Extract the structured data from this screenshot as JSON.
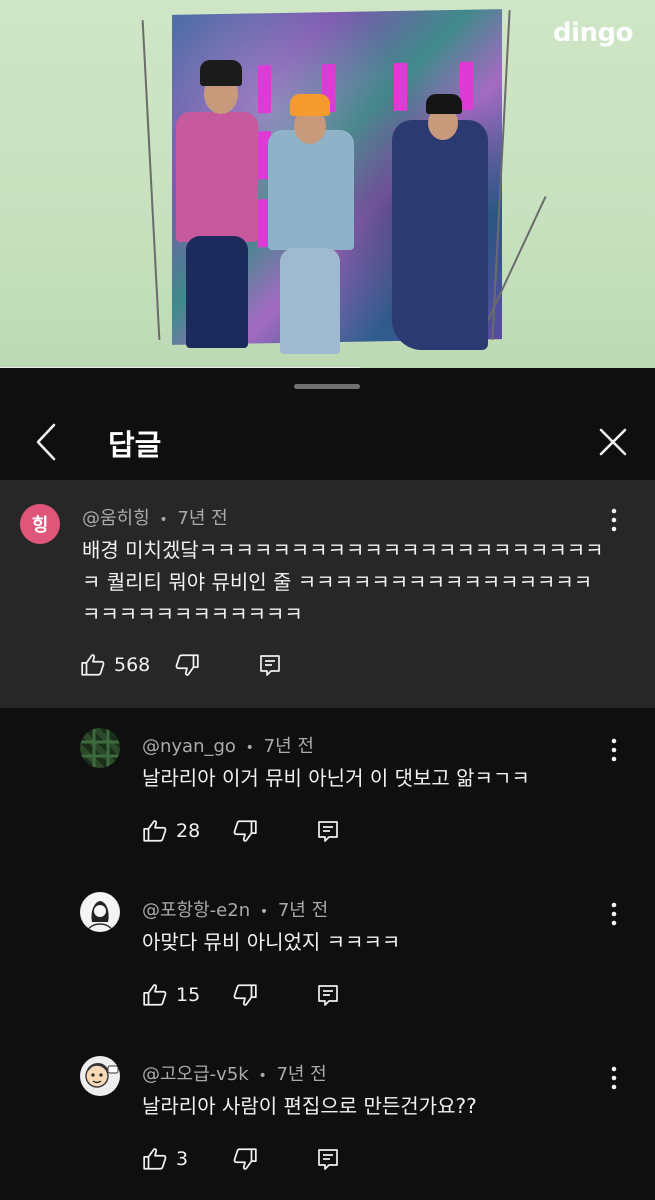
{
  "video": {
    "logo": "dingo"
  },
  "panel": {
    "title": "답글"
  },
  "parent_comment": {
    "avatar_text": "힝",
    "avatar_color": "#e0557a",
    "author": "@움히힝",
    "time": "7년 전",
    "text": "배경 미치겠닼ㅋㅋㅋㅋㅋㅋㅋㅋㅋㅋㅋㅋㅋㅋㅋㅋㅋㅋㅋㅋㅋㅋㅋ 퀄리티 뭐야 뮤비인 줄 ㅋㅋㅋㅋㅋㅋㅋㅋㅋㅋㅋㅋㅋㅋㅋㅋㅋㅋㅋㅋㅋㅋㅋㅋㅋㅋㅋㅋ",
    "likes": "568"
  },
  "replies": [
    {
      "author": "@nyan_go",
      "time": "7년 전",
      "text": "날라리아 이거 뮤비 아닌거 이 댓보고 앎ㅋㄱㅋ",
      "likes": "28",
      "avatar": "plaid-avatar"
    },
    {
      "author": "@포항항-e2n",
      "time": "7년 전",
      "text": "아맞다 뮤비 아니었지 ㅋㅋㅋㅋ",
      "likes": "15",
      "avatar": "sketch-avatar"
    },
    {
      "author": "@고오급-v5k",
      "time": "7년 전",
      "text": "날라리아 사람이 편집으로 만든건가요??",
      "likes": "3",
      "avatar": "cartoon-avatar"
    }
  ],
  "separator": "•"
}
